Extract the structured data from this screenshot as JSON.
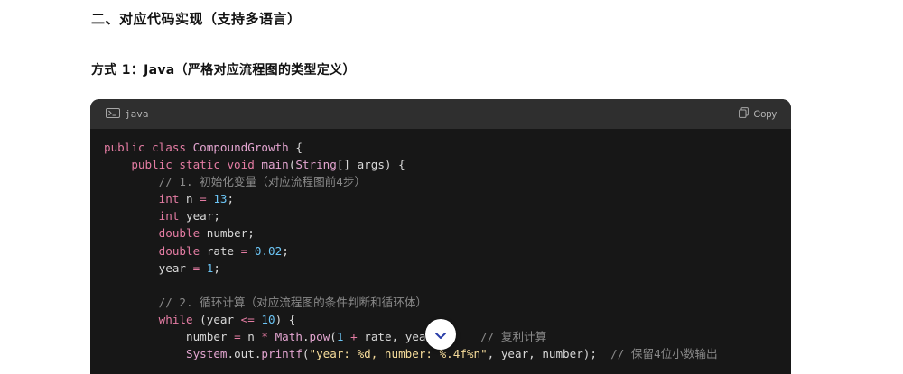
{
  "heading_section": "二、对应代码实现（支持多语言）",
  "heading_subsection": "方式 1：Java（严格对应流程图的类型定义）",
  "code_block": {
    "language": "java",
    "copy_label": "Copy",
    "icons": {
      "language": "terminal-icon",
      "copy": "copy-icon",
      "scroll": "chevron-down-icon"
    },
    "lines": [
      {
        "parts": [
          {
            "t": "public class ",
            "c": "kw"
          },
          {
            "t": "CompoundGrowth",
            "c": "cls"
          },
          {
            "t": " {",
            "c": "op"
          }
        ]
      },
      {
        "parts": [
          {
            "t": "    public static void ",
            "c": "kw"
          },
          {
            "t": "main",
            "c": "fn"
          },
          {
            "t": "(",
            "c": "op"
          },
          {
            "t": "String",
            "c": "cls"
          },
          {
            "t": "[] args) {",
            "c": "op"
          }
        ]
      },
      {
        "parts": [
          {
            "t": "        // 1. 初始化变量（对应流程图前4步）",
            "c": "cm"
          }
        ]
      },
      {
        "parts": [
          {
            "t": "        int",
            "c": "kw"
          },
          {
            "t": " n ",
            "c": "op"
          },
          {
            "t": "=",
            "c": "kw"
          },
          {
            "t": " ",
            "c": "op"
          },
          {
            "t": "13",
            "c": "num"
          },
          {
            "t": ";",
            "c": "op"
          }
        ]
      },
      {
        "parts": [
          {
            "t": "        int",
            "c": "kw"
          },
          {
            "t": " year;",
            "c": "op"
          }
        ]
      },
      {
        "parts": [
          {
            "t": "        double",
            "c": "kw"
          },
          {
            "t": " number;",
            "c": "op"
          }
        ]
      },
      {
        "parts": [
          {
            "t": "        double",
            "c": "kw"
          },
          {
            "t": " rate ",
            "c": "op"
          },
          {
            "t": "=",
            "c": "kw"
          },
          {
            "t": " ",
            "c": "op"
          },
          {
            "t": "0.02",
            "c": "num"
          },
          {
            "t": ";",
            "c": "op"
          }
        ]
      },
      {
        "parts": [
          {
            "t": "        year ",
            "c": "op"
          },
          {
            "t": "=",
            "c": "kw"
          },
          {
            "t": " ",
            "c": "op"
          },
          {
            "t": "1",
            "c": "num"
          },
          {
            "t": ";",
            "c": "op"
          }
        ]
      },
      {
        "parts": [
          {
            "t": "",
            "c": "op"
          }
        ]
      },
      {
        "parts": [
          {
            "t": "        // 2. 循环计算（对应流程图的条件判断和循环体）",
            "c": "cm"
          }
        ]
      },
      {
        "parts": [
          {
            "t": "        while",
            "c": "kw"
          },
          {
            "t": " (year ",
            "c": "op"
          },
          {
            "t": "<=",
            "c": "kw"
          },
          {
            "t": " ",
            "c": "op"
          },
          {
            "t": "10",
            "c": "num"
          },
          {
            "t": ") {",
            "c": "op"
          }
        ]
      },
      {
        "parts": [
          {
            "t": "            number ",
            "c": "op"
          },
          {
            "t": "=",
            "c": "kw"
          },
          {
            "t": " n ",
            "c": "op"
          },
          {
            "t": "*",
            "c": "kw"
          },
          {
            "t": " ",
            "c": "op"
          },
          {
            "t": "Math",
            "c": "cls"
          },
          {
            "t": ".",
            "c": "op"
          },
          {
            "t": "pow",
            "c": "fn"
          },
          {
            "t": "(",
            "c": "op"
          },
          {
            "t": "1",
            "c": "num"
          },
          {
            "t": " ",
            "c": "op"
          },
          {
            "t": "+",
            "c": "kw"
          },
          {
            "t": " rate, yea",
            "c": "op"
          },
          {
            "t": "        ",
            "c": "op"
          },
          {
            "t": "// 复利计算",
            "c": "cm"
          }
        ]
      },
      {
        "parts": [
          {
            "t": "            ",
            "c": "op"
          },
          {
            "t": "System",
            "c": "cls"
          },
          {
            "t": ".out.",
            "c": "op"
          },
          {
            "t": "printf",
            "c": "fn"
          },
          {
            "t": "(",
            "c": "op"
          },
          {
            "t": "\"year: %d, number: %.4f%n\"",
            "c": "str"
          },
          {
            "t": ", year, number);  ",
            "c": "op"
          },
          {
            "t": "// 保留4位小数输出",
            "c": "cm"
          }
        ]
      }
    ]
  }
}
